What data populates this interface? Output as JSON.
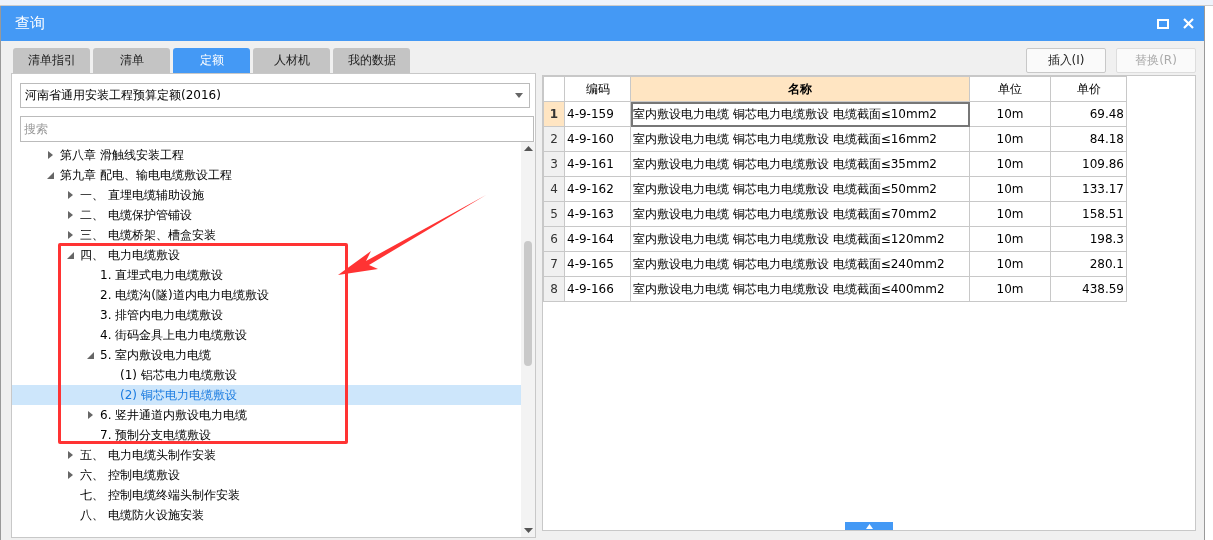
{
  "window": {
    "title": "查询"
  },
  "tabs": [
    {
      "label": "清单指引",
      "selected": false
    },
    {
      "label": "清单",
      "selected": false
    },
    {
      "label": "定额",
      "selected": true
    },
    {
      "label": "人材机",
      "selected": false
    },
    {
      "label": "我的数据",
      "selected": false
    }
  ],
  "buttons": [
    {
      "label": "插入(I)",
      "disabled": false
    },
    {
      "label": "替换(R)",
      "disabled": true
    }
  ],
  "library_select": {
    "value": "河南省通用安装工程预算定额(2016)"
  },
  "search": {
    "placeholder": "搜索"
  },
  "tree": [
    {
      "label": "第八章 滑触线安装工程",
      "expanded": false,
      "selected": false
    },
    {
      "label": "第九章 配电、输电电缆敷设工程",
      "expanded": true,
      "selected": false,
      "children": [
        {
          "label": "一、 直埋电缆辅助设施",
          "expanded": false,
          "selected": false
        },
        {
          "label": "二、 电缆保护管铺设",
          "expanded": false,
          "selected": false
        },
        {
          "label": "三、 电缆桥架、槽盒安装",
          "expanded": false,
          "selected": false
        },
        {
          "label": "四、 电力电缆敷设",
          "expanded": true,
          "selected": false,
          "children": [
            {
              "label": "1. 直埋式电力电缆敷设",
              "selected": false
            },
            {
              "label": "2. 电缆沟(隧)道内电力电缆敷设",
              "selected": false
            },
            {
              "label": "3. 排管内电力电缆敷设",
              "selected": false
            },
            {
              "label": "4. 街码金具上电力电缆敷设",
              "selected": false
            },
            {
              "label": "5. 室内敷设电力电缆",
              "expanded": true,
              "selected": false,
              "children": [
                {
                  "label": "(1) 铝芯电力电缆敷设",
                  "selected": false
                },
                {
                  "label": "(2) 铜芯电力电缆敷设",
                  "selected": true
                }
              ]
            },
            {
              "label": "6. 竖井通道内敷设电力电缆",
              "expanded": false,
              "selected": false
            },
            {
              "label": "7. 预制分支电缆敷设",
              "selected": false
            }
          ]
        },
        {
          "label": "五、 电力电缆头制作安装",
          "expanded": false,
          "selected": false
        },
        {
          "label": "六、 控制电缆敷设",
          "expanded": false,
          "selected": false
        },
        {
          "label": "七、 控制电缆终端头制作安装",
          "selected": false
        },
        {
          "label": "八、 电缆防火设施安装",
          "selected": false
        }
      ]
    }
  ],
  "table": {
    "columns": [
      "编码",
      "名称",
      "单位",
      "单价"
    ],
    "rows": [
      {
        "index": "1",
        "code": "4-9-159",
        "name": "室内敷设电力电缆 铜芯电力电缆敷设 电缆截面≤10mm2",
        "unit": "10m",
        "price": "69.48",
        "selected": true
      },
      {
        "index": "2",
        "code": "4-9-160",
        "name": "室内敷设电力电缆 铜芯电力电缆敷设 电缆截面≤16mm2",
        "unit": "10m",
        "price": "84.18",
        "selected": false
      },
      {
        "index": "3",
        "code": "4-9-161",
        "name": "室内敷设电力电缆 铜芯电力电缆敷设 电缆截面≤35mm2",
        "unit": "10m",
        "price": "109.86",
        "selected": false
      },
      {
        "index": "4",
        "code": "4-9-162",
        "name": "室内敷设电力电缆 铜芯电力电缆敷设 电缆截面≤50mm2",
        "unit": "10m",
        "price": "133.17",
        "selected": false
      },
      {
        "index": "5",
        "code": "4-9-163",
        "name": "室内敷设电力电缆 铜芯电力电缆敷设 电缆截面≤70mm2",
        "unit": "10m",
        "price": "158.51",
        "selected": false
      },
      {
        "index": "6",
        "code": "4-9-164",
        "name": "室内敷设电力电缆 铜芯电力电缆敷设 电缆截面≤120mm2",
        "unit": "10m",
        "price": "198.3",
        "selected": false
      },
      {
        "index": "7",
        "code": "4-9-165",
        "name": "室内敷设电力电缆 铜芯电力电缆敷设 电缆截面≤240mm2",
        "unit": "10m",
        "price": "280.1",
        "selected": false
      },
      {
        "index": "8",
        "code": "4-9-166",
        "name": "室内敷设电力电缆 铜芯电力电缆敷设 电缆截面≤400mm2",
        "unit": "10m",
        "price": "438.59",
        "selected": false
      }
    ]
  }
}
